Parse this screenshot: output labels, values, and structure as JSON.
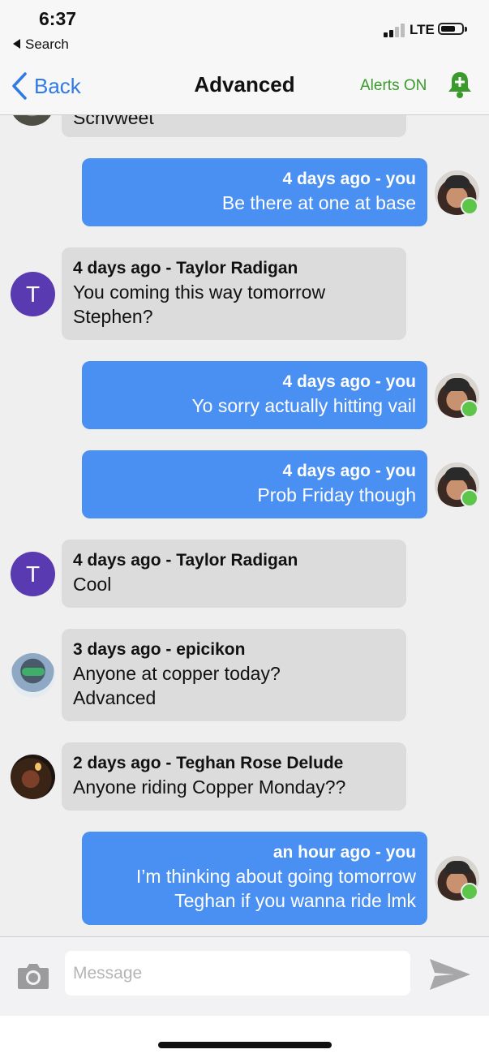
{
  "status_bar": {
    "time": "6:37",
    "back_app": "Search",
    "network": "LTE"
  },
  "nav": {
    "back_label": "Back",
    "title": "Advanced",
    "alerts_label": "Alerts ON"
  },
  "messages": [
    {
      "direction": "in",
      "meta": "",
      "text": "Schvweet"
    },
    {
      "direction": "out",
      "meta": "4 days ago - you",
      "text": "Be there at one at base"
    },
    {
      "direction": "in",
      "avatar_letter": "T",
      "meta": "4 days ago - Taylor Radigan",
      "text": "You coming this way tomorrow\nStephen?"
    },
    {
      "direction": "out",
      "meta": "4 days ago - you",
      "text": "Yo sorry actually hitting vail"
    },
    {
      "direction": "out",
      "meta": "4 days ago - you",
      "text": "Prob Friday though"
    },
    {
      "direction": "in",
      "avatar_letter": "T",
      "meta": "4 days ago - Taylor Radigan",
      "text": "Cool"
    },
    {
      "direction": "in",
      "meta": "3 days ago - epicikon",
      "text": "Anyone at copper today?\nAdvanced"
    },
    {
      "direction": "in",
      "meta": "2 days ago - Teghan Rose Delude",
      "text": "Anyone riding Copper Monday??"
    },
    {
      "direction": "out",
      "meta": "an hour ago - you",
      "text": "I’m thinking about going tomorrow\nTeghan if you wanna ride lmk"
    }
  ],
  "composer": {
    "placeholder": "Message"
  },
  "colors": {
    "accent": "#2f7ae5",
    "outgoing_bubble": "#4a8ff2",
    "incoming_bubble": "#dcdcdd",
    "alerts": "#3a9a2c",
    "online": "#5cc54a",
    "avatar_letter_bg": "#5a3ab0"
  }
}
